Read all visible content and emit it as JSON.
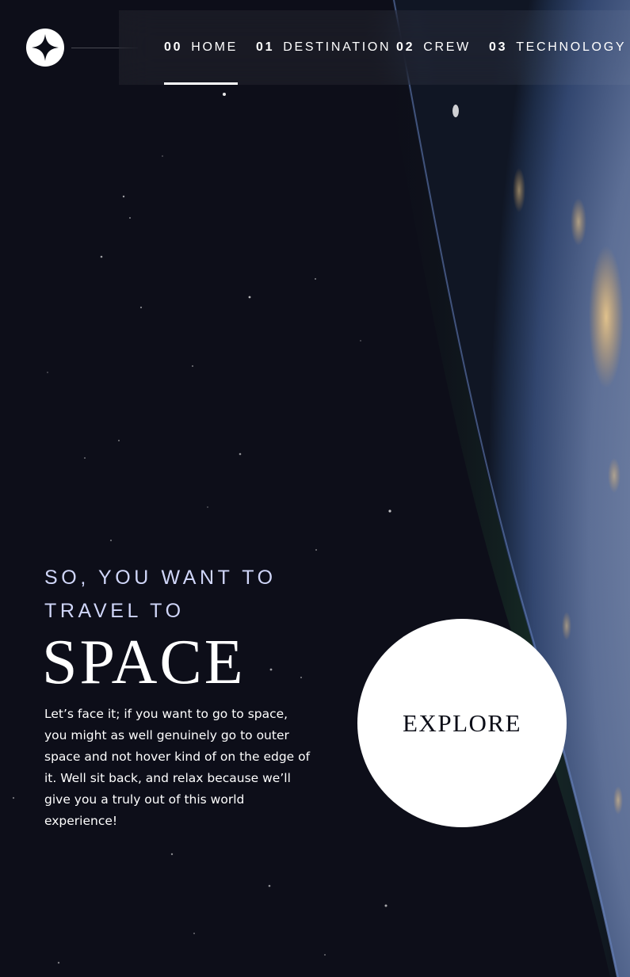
{
  "colors": {
    "background": "#0b0d17",
    "accent_light": "#d0d6f9",
    "white": "#ffffff"
  },
  "header": {
    "logo_icon": "four-point-star-icon",
    "nav": [
      {
        "number": "00",
        "label": "HOME",
        "active": true
      },
      {
        "number": "01",
        "label": "DESTINATION",
        "active": false
      },
      {
        "number": "02",
        "label": "CREW",
        "active": false
      },
      {
        "number": "03",
        "label": "TECHNOLOGY",
        "active": false
      }
    ]
  },
  "hero": {
    "subtitle_line1": "SO, YOU WANT TO",
    "subtitle_line2": "TRAVEL TO",
    "title": "SPACE",
    "body": "Let’s face it; if you want to go to space, you might as well genuinely go to outer space and not hover kind of on the edge of it. Well sit back, and relax because we’ll give you a truly out of this world experience!"
  },
  "explore": {
    "label": "EXPLORE"
  }
}
